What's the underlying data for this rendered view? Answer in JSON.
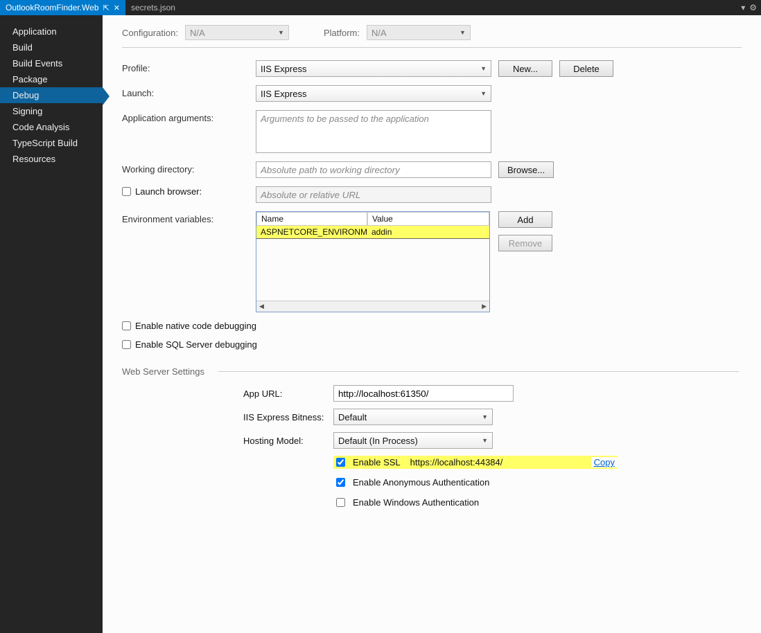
{
  "tabs": [
    {
      "label": "OutlookRoomFinder.Web",
      "active": true
    },
    {
      "label": "secrets.json",
      "active": false
    }
  ],
  "sidebar": {
    "items": [
      "Application",
      "Build",
      "Build Events",
      "Package",
      "Debug",
      "Signing",
      "Code Analysis",
      "TypeScript Build",
      "Resources"
    ],
    "selected_index": 4
  },
  "top": {
    "config_label": "Configuration:",
    "config_value": "N/A",
    "platform_label": "Platform:",
    "platform_value": "N/A"
  },
  "form": {
    "profile_label": "Profile:",
    "profile_value": "IIS Express",
    "new_btn": "New...",
    "delete_btn": "Delete",
    "launch_label": "Launch:",
    "launch_value": "IIS Express",
    "appargs_label": "Application arguments:",
    "appargs_placeholder": "Arguments to be passed to the application",
    "workdir_label": "Working directory:",
    "workdir_placeholder": "Absolute path to working directory",
    "browse_btn": "Browse...",
    "launch_browser_label": "Launch browser:",
    "launch_browser_checked": false,
    "launch_browser_placeholder": "Absolute or relative URL",
    "envvars_label": "Environment variables:",
    "env_name_hdr": "Name",
    "env_value_hdr": "Value",
    "env_rows": [
      {
        "name": "ASPNETCORE_ENVIRONMENT",
        "value": "addin"
      }
    ],
    "add_btn": "Add",
    "remove_btn": "Remove",
    "native_label": "Enable native code debugging",
    "native_checked": false,
    "sql_label": "Enable SQL Server debugging",
    "sql_checked": false
  },
  "ws": {
    "section_title": "Web Server Settings",
    "appurl_label": "App URL:",
    "appurl_value": "http://localhost:61350/",
    "bitness_label": "IIS Express Bitness:",
    "bitness_value": "Default",
    "hosting_label": "Hosting Model:",
    "hosting_value": "Default (In Process)",
    "ssl_label": "Enable SSL",
    "ssl_checked": true,
    "ssl_url": "https://localhost:44384/",
    "copy_label": "Copy",
    "anon_label": "Enable Anonymous Authentication",
    "anon_checked": true,
    "win_label": "Enable Windows Authentication",
    "win_checked": false
  }
}
